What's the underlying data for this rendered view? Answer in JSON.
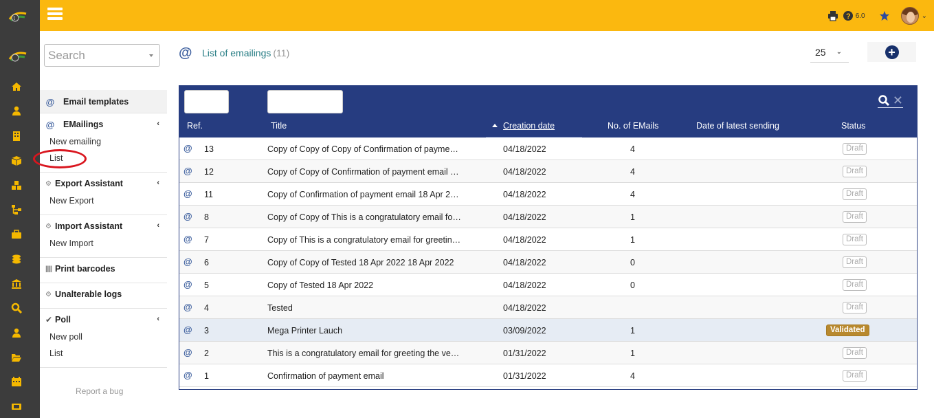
{
  "topbar": {
    "version": "6.0"
  },
  "sidebar": {
    "search_placeholder": "Search",
    "email_templates": "Email templates",
    "emailings": {
      "label": "EMailings",
      "new": "New emailing",
      "list": "List"
    },
    "export": {
      "label": "Export Assistant",
      "new": "New Export"
    },
    "import": {
      "label": "Import Assistant",
      "new": "New Import"
    },
    "barcodes": "Print barcodes",
    "logs": "Unalterable logs",
    "poll": {
      "label": "Poll",
      "new": "New poll",
      "list": "List"
    },
    "report_bug": "Report a bug"
  },
  "main": {
    "title": "List of emailings",
    "count": "(11)",
    "per_page": "25"
  },
  "table": {
    "headers": {
      "ref": "Ref.",
      "title": "Title",
      "creation_date": "Creation date",
      "num_emails": "No. of EMails",
      "latest_sending": "Date of latest sending",
      "status": "Status"
    },
    "rows": [
      {
        "ref": "13",
        "title": "Copy of Copy of Copy of Confirmation of payment ...",
        "date": "04/18/2022",
        "num": "4",
        "status": "Draft"
      },
      {
        "ref": "12",
        "title": "Copy of Copy of Confirmation of payment email 1...",
        "date": "04/18/2022",
        "num": "4",
        "status": "Draft"
      },
      {
        "ref": "11",
        "title": "Copy of Confirmation of payment email 18 Apr 2022",
        "date": "04/18/2022",
        "num": "4",
        "status": "Draft"
      },
      {
        "ref": "8",
        "title": "Copy of Copy of This is a congratulatory email for ...",
        "date": "04/18/2022",
        "num": "1",
        "status": "Draft"
      },
      {
        "ref": "7",
        "title": "Copy of This is a congratulatory email for greeting...",
        "date": "04/18/2022",
        "num": "1",
        "status": "Draft"
      },
      {
        "ref": "6",
        "title": "Copy of Copy of Tested 18 Apr 2022 18 Apr 2022",
        "date": "04/18/2022",
        "num": "0",
        "status": "Draft"
      },
      {
        "ref": "5",
        "title": "Copy of Tested 18 Apr 2022",
        "date": "04/18/2022",
        "num": "0",
        "status": "Draft"
      },
      {
        "ref": "4",
        "title": "Tested",
        "date": "04/18/2022",
        "num": "",
        "status": "Draft"
      },
      {
        "ref": "3",
        "title": "Mega Printer Lauch",
        "date": "03/09/2022",
        "num": "1",
        "status": "Validated"
      },
      {
        "ref": "2",
        "title": "This is a congratulatory email for greeting the ven...",
        "date": "01/31/2022",
        "num": "1",
        "status": "Draft"
      },
      {
        "ref": "1",
        "title": "Confirmation of payment email",
        "date": "01/31/2022",
        "num": "4",
        "status": "Draft"
      }
    ]
  },
  "colors": {
    "accent": "#fbb80f",
    "table_header": "#263c80",
    "rail": "#3c3c3c",
    "validated": "#b8892e"
  }
}
